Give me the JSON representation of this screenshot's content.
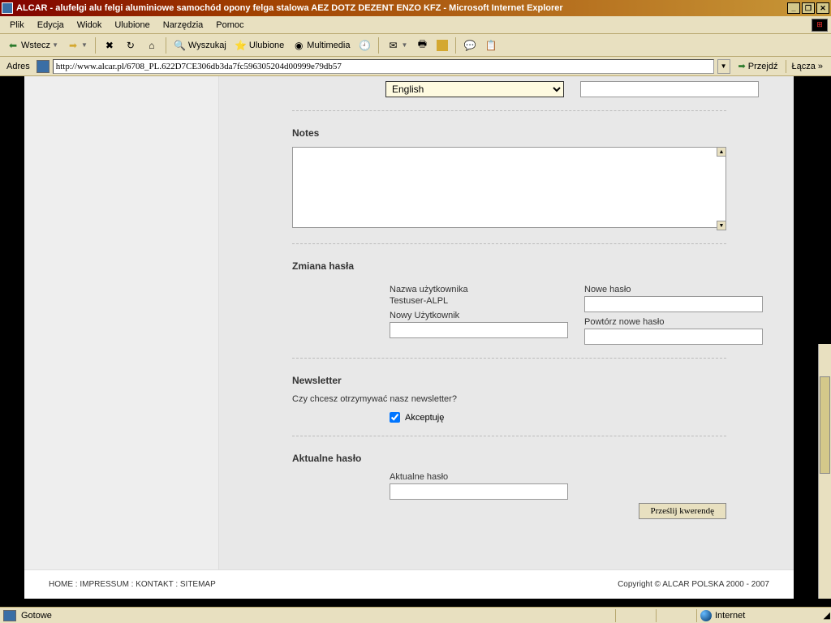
{
  "window": {
    "title": "ALCAR - alufelgi alu felgi aluminiowe samochód opony felga stalowa AEZ DOTZ DEZENT ENZO KFZ - Microsoft Internet Explorer"
  },
  "menu": {
    "items": [
      "Plik",
      "Edycja",
      "Widok",
      "Ulubione",
      "Narzędzia",
      "Pomoc"
    ]
  },
  "toolbar": {
    "back": "Wstecz",
    "search": "Wyszukaj",
    "favorites": "Ulubione",
    "media": "Multimedia"
  },
  "address": {
    "label": "Adres",
    "url": "http://www.alcar.pl/6708_PL.622D7CE306db3da7fc596305204d00999e79db57",
    "go": "Przejdź",
    "links": "Łącza"
  },
  "form": {
    "language_selected": "English",
    "notes_heading": "Notes",
    "password_heading": "Zmiana hasła",
    "username_label": "Nazwa użytkownika",
    "username_value": "Testuser-ALPL",
    "newuser_label": "Nowy Użytkownik",
    "newpass_label": "Nowe hasło",
    "repeatpass_label": "Powtórz nowe hasło",
    "newsletter_heading": "Newsletter",
    "newsletter_question": "Czy chcesz otrzymywać nasz newsletter?",
    "accept_label": "Akceptuję",
    "currentpass_heading": "Aktualne hasło",
    "currentpass_label": "Aktualne hasło",
    "submit": "Prześlij kwerendę"
  },
  "footer": {
    "links": "HOME : IMPRESSUM : KONTAKT : SITEMAP",
    "copyright": "Copyright © ALCAR POLSKA 2000 - 2007"
  },
  "status": {
    "text": "Gotowe",
    "zone": "Internet"
  }
}
